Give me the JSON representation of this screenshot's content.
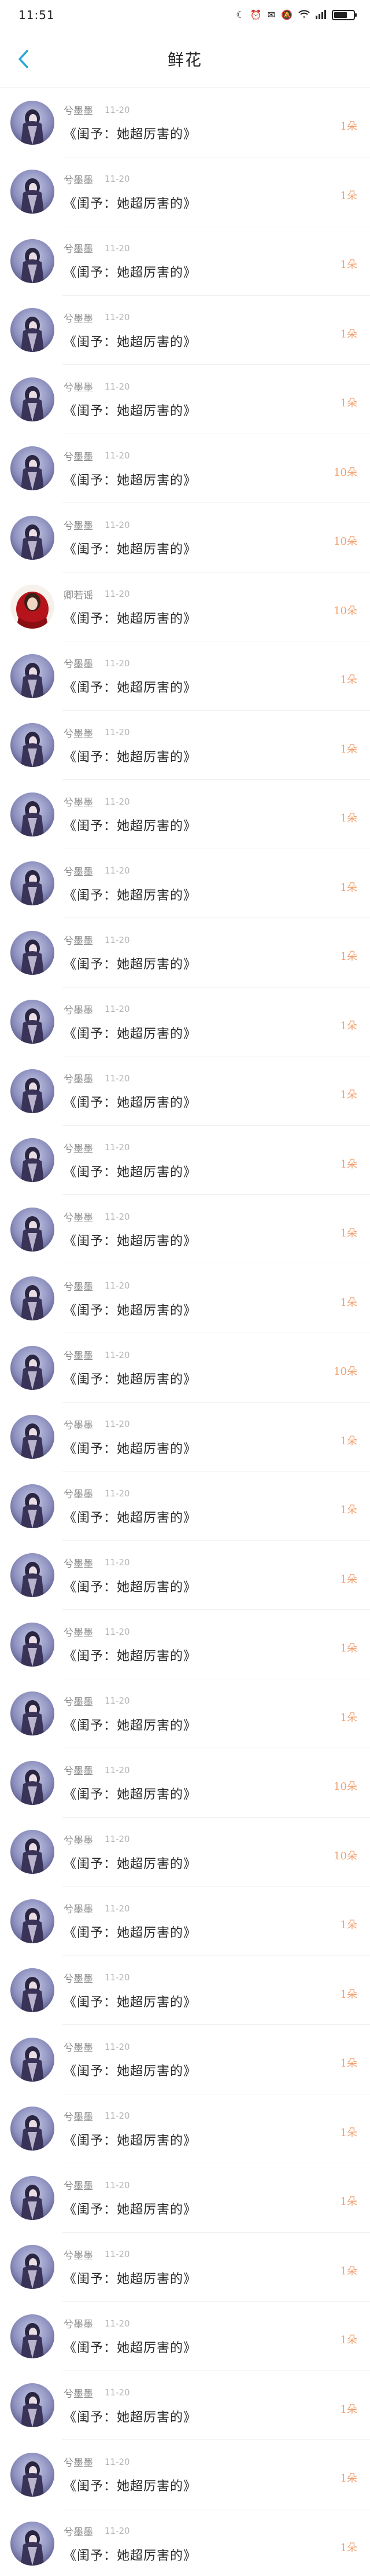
{
  "status_bar": {
    "time": "11:51",
    "icons": [
      "moon-icon",
      "alarm-icon",
      "mail-icon",
      "mute-icon",
      "wifi-icon",
      "signal-icon",
      "battery-icon"
    ]
  },
  "nav": {
    "title": "鲜花",
    "back_icon": "chevron-left-icon",
    "accent": "#2aa7d8"
  },
  "colors": {
    "count": "#f0a070"
  },
  "rows": [
    {
      "avatar": "girl",
      "name": "兮墨墨",
      "time": "11-20",
      "content": "《闺予：她超厉害的》",
      "count": "1朵"
    },
    {
      "avatar": "girl",
      "name": "兮墨墨",
      "time": "11-20",
      "content": "《闺予：她超厉害的》",
      "count": "1朵"
    },
    {
      "avatar": "girl",
      "name": "兮墨墨",
      "time": "11-20",
      "content": "《闺予：她超厉害的》",
      "count": "1朵"
    },
    {
      "avatar": "girl",
      "name": "兮墨墨",
      "time": "11-20",
      "content": "《闺予：她超厉害的》",
      "count": "1朵"
    },
    {
      "avatar": "girl",
      "name": "兮墨墨",
      "time": "11-20",
      "content": "《闺予：她超厉害的》",
      "count": "1朵"
    },
    {
      "avatar": "girl",
      "name": "兮墨墨",
      "time": "11-20",
      "content": "《闺予：她超厉害的》",
      "count": "10朵"
    },
    {
      "avatar": "girl",
      "name": "兮墨墨",
      "time": "11-20",
      "content": "《闺予：她超厉害的》",
      "count": "10朵"
    },
    {
      "avatar": "red",
      "name": "卿若谣",
      "time": "11-20",
      "content": "《闺予：她超厉害的》",
      "count": "10朵"
    },
    {
      "avatar": "girl",
      "name": "兮墨墨",
      "time": "11-20",
      "content": "《闺予：她超厉害的》",
      "count": "1朵"
    },
    {
      "avatar": "girl",
      "name": "兮墨墨",
      "time": "11-20",
      "content": "《闺予：她超厉害的》",
      "count": "1朵"
    },
    {
      "avatar": "girl",
      "name": "兮墨墨",
      "time": "11-20",
      "content": "《闺予：她超厉害的》",
      "count": "1朵"
    },
    {
      "avatar": "girl",
      "name": "兮墨墨",
      "time": "11-20",
      "content": "《闺予：她超厉害的》",
      "count": "1朵"
    },
    {
      "avatar": "girl",
      "name": "兮墨墨",
      "time": "11-20",
      "content": "《闺予：她超厉害的》",
      "count": "1朵"
    },
    {
      "avatar": "girl",
      "name": "兮墨墨",
      "time": "11-20",
      "content": "《闺予：她超厉害的》",
      "count": "1朵"
    },
    {
      "avatar": "girl",
      "name": "兮墨墨",
      "time": "11-20",
      "content": "《闺予：她超厉害的》",
      "count": "1朵"
    },
    {
      "avatar": "girl",
      "name": "兮墨墨",
      "time": "11-20",
      "content": "《闺予：她超厉害的》",
      "count": "1朵"
    },
    {
      "avatar": "girl",
      "name": "兮墨墨",
      "time": "11-20",
      "content": "《闺予：她超厉害的》",
      "count": "1朵"
    },
    {
      "avatar": "girl",
      "name": "兮墨墨",
      "time": "11-20",
      "content": "《闺予：她超厉害的》",
      "count": "1朵"
    },
    {
      "avatar": "girl",
      "name": "兮墨墨",
      "time": "11-20",
      "content": "《闺予：她超厉害的》",
      "count": "10朵"
    },
    {
      "avatar": "girl",
      "name": "兮墨墨",
      "time": "11-20",
      "content": "《闺予：她超厉害的》",
      "count": "1朵"
    },
    {
      "avatar": "girl",
      "name": "兮墨墨",
      "time": "11-20",
      "content": "《闺予：她超厉害的》",
      "count": "1朵"
    },
    {
      "avatar": "girl",
      "name": "兮墨墨",
      "time": "11-20",
      "content": "《闺予：她超厉害的》",
      "count": "1朵"
    },
    {
      "avatar": "girl",
      "name": "兮墨墨",
      "time": "11-20",
      "content": "《闺予：她超厉害的》",
      "count": "1朵"
    },
    {
      "avatar": "girl",
      "name": "兮墨墨",
      "time": "11-20",
      "content": "《闺予：她超厉害的》",
      "count": "1朵"
    },
    {
      "avatar": "girl",
      "name": "兮墨墨",
      "time": "11-20",
      "content": "《闺予：她超厉害的》",
      "count": "10朵"
    },
    {
      "avatar": "girl",
      "name": "兮墨墨",
      "time": "11-20",
      "content": "《闺予：她超厉害的》",
      "count": "10朵"
    },
    {
      "avatar": "girl",
      "name": "兮墨墨",
      "time": "11-20",
      "content": "《闺予：她超厉害的》",
      "count": "1朵"
    },
    {
      "avatar": "girl",
      "name": "兮墨墨",
      "time": "11-20",
      "content": "《闺予：她超厉害的》",
      "count": "1朵"
    },
    {
      "avatar": "girl",
      "name": "兮墨墨",
      "time": "11-20",
      "content": "《闺予：她超厉害的》",
      "count": "1朵"
    },
    {
      "avatar": "girl",
      "name": "兮墨墨",
      "time": "11-20",
      "content": "《闺予：她超厉害的》",
      "count": "1朵"
    },
    {
      "avatar": "girl",
      "name": "兮墨墨",
      "time": "11-20",
      "content": "《闺予：她超厉害的》",
      "count": "1朵"
    },
    {
      "avatar": "girl",
      "name": "兮墨墨",
      "time": "11-20",
      "content": "《闺予：她超厉害的》",
      "count": "1朵"
    },
    {
      "avatar": "girl",
      "name": "兮墨墨",
      "time": "11-20",
      "content": "《闺予：她超厉害的》",
      "count": "1朵"
    },
    {
      "avatar": "girl",
      "name": "兮墨墨",
      "time": "11-20",
      "content": "《闺予：她超厉害的》",
      "count": "1朵"
    },
    {
      "avatar": "girl",
      "name": "兮墨墨",
      "time": "11-20",
      "content": "《闺予：她超厉害的》",
      "count": "1朵"
    },
    {
      "avatar": "girl",
      "name": "兮墨墨",
      "time": "11-20",
      "content": "《闺予：她超厉害的》",
      "count": "1朵"
    }
  ]
}
